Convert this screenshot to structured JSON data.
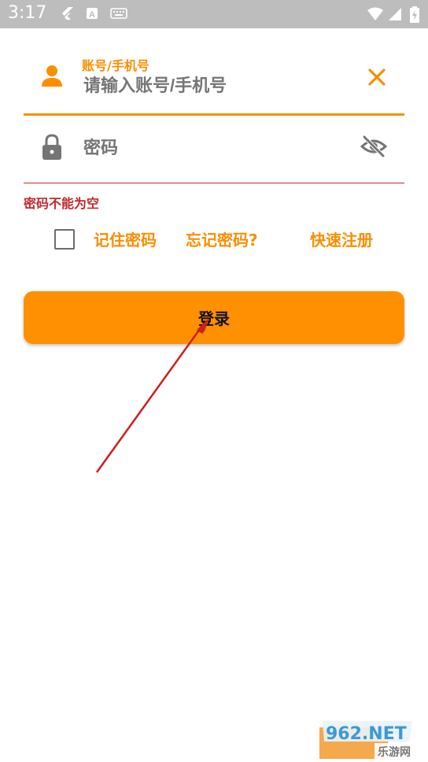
{
  "status_bar": {
    "time": "3:17",
    "icons": [
      "flutter-icon",
      "a-box-icon",
      "keyboard-icon",
      "wifi-icon",
      "signal-icon",
      "battery-icon"
    ]
  },
  "account": {
    "label": "账号/手机号",
    "placeholder": "请输入账号/手机号",
    "left_icon": "person-icon",
    "clear_icon": "close-icon"
  },
  "password": {
    "placeholder": "密码",
    "left_icon": "lock-icon",
    "toggle_icon": "visibility-off-icon",
    "error": "密码不能为空"
  },
  "options": {
    "remember": "记住密码",
    "forgot": "忘记密码?",
    "register": "快速注册"
  },
  "login": {
    "label": "登录"
  },
  "watermark": {
    "text": "962.NET",
    "subtext": "乐游网"
  },
  "colors": {
    "accent": "#fa8e00",
    "button": "#ff9002",
    "error": "#c0282d",
    "status_bar": "#bdbdbd",
    "annotation_arrow": "#cc1f1f"
  }
}
